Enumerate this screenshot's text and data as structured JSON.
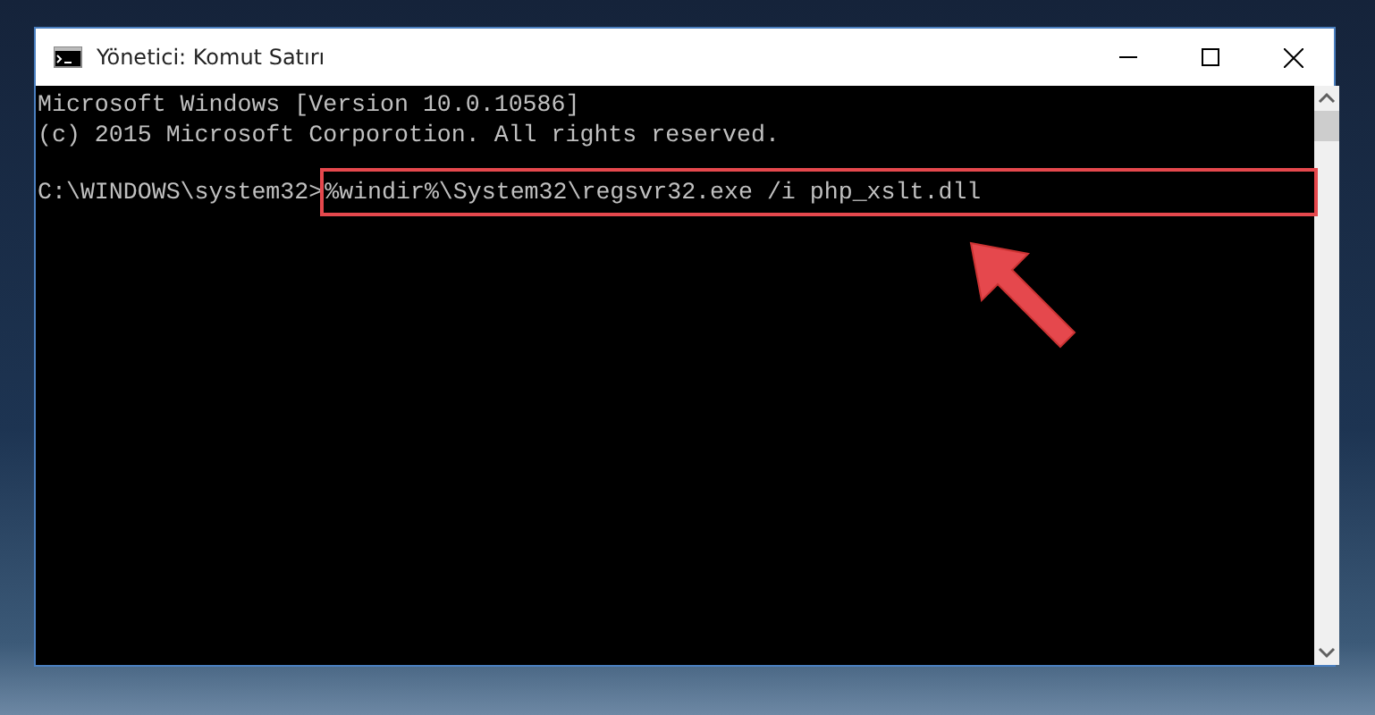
{
  "window": {
    "title": "Yönetici: Komut Satırı"
  },
  "console": {
    "lines": [
      "Microsoft Windows [Version 10.0.10586]",
      "(c) 2015 Microsoft Corporotion. All rights reserved."
    ],
    "prompt": "C:\\WINDOWS\\system32>",
    "command": "%windir%\\System32\\regsvr32.exe /i php_xslt.dll",
    "command_highlighted": true
  }
}
